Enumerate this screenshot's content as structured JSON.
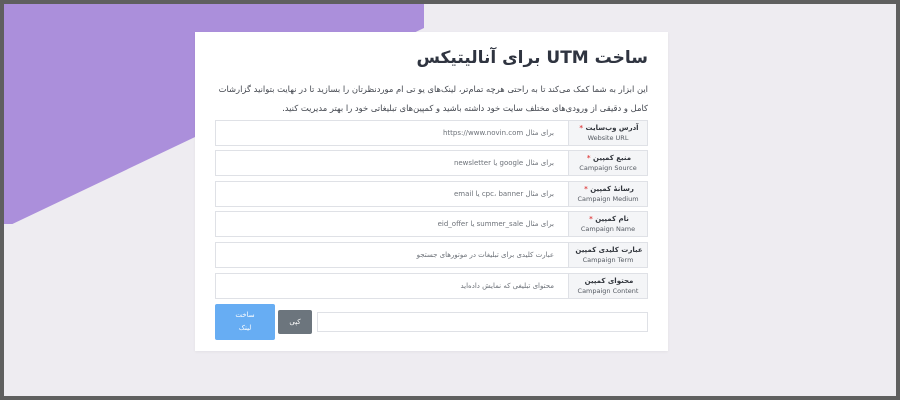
{
  "card": {
    "title": "ساخت UTM برای آنالیتیکس",
    "description": "این ابزار به شما کمک می‌کند تا به راحتی هرچه تمام‌تر، لینک‌های یو تی ام موردنظرتان را بسازید تا در نهایت بتوانید گزارشات کامل و دقیقی از ورودی‌های مختلف سایت خود داشته باشید و کمپین‌های تبلیغاتی خود را بهتر مدیریت کنید."
  },
  "fields": [
    {
      "label_fa": "آدرس وب‌سایت",
      "label_en": "Website URL",
      "required": "*",
      "placeholder": "برای مثال https://www.novin.com"
    },
    {
      "label_fa": "منبع کمپین",
      "label_en": "Campaign Source",
      "required": "*",
      "placeholder": "برای مثال google یا newsletter"
    },
    {
      "label_fa": "رسانهٔ کمپین",
      "label_en": "Campaign Medium",
      "required": "*",
      "placeholder": "برای مثال cpc، banner یا email"
    },
    {
      "label_fa": "نام کمپین",
      "label_en": "Campaign Name",
      "required": "*",
      "placeholder": "برای مثال summer_sale یا eid_offer"
    },
    {
      "label_fa": "عبارت کلیدی کمپین",
      "label_en": "Campaign Term",
      "required": "",
      "placeholder": "عبارت کلیدی برای تبلیغات در موتورهای جستجو"
    },
    {
      "label_fa": "محتوای کمپین",
      "label_en": "Campaign Content",
      "required": "",
      "placeholder": "محتوای تبلیغی که نمایش داده‌اید"
    }
  ],
  "actions": {
    "build_line1": "ساخت",
    "build_line2": "لینک",
    "copy": "کپی",
    "output_value": ""
  },
  "colors": {
    "accent": "#67adf3",
    "wedge": "#ab8fdb",
    "required": "#e04848"
  }
}
